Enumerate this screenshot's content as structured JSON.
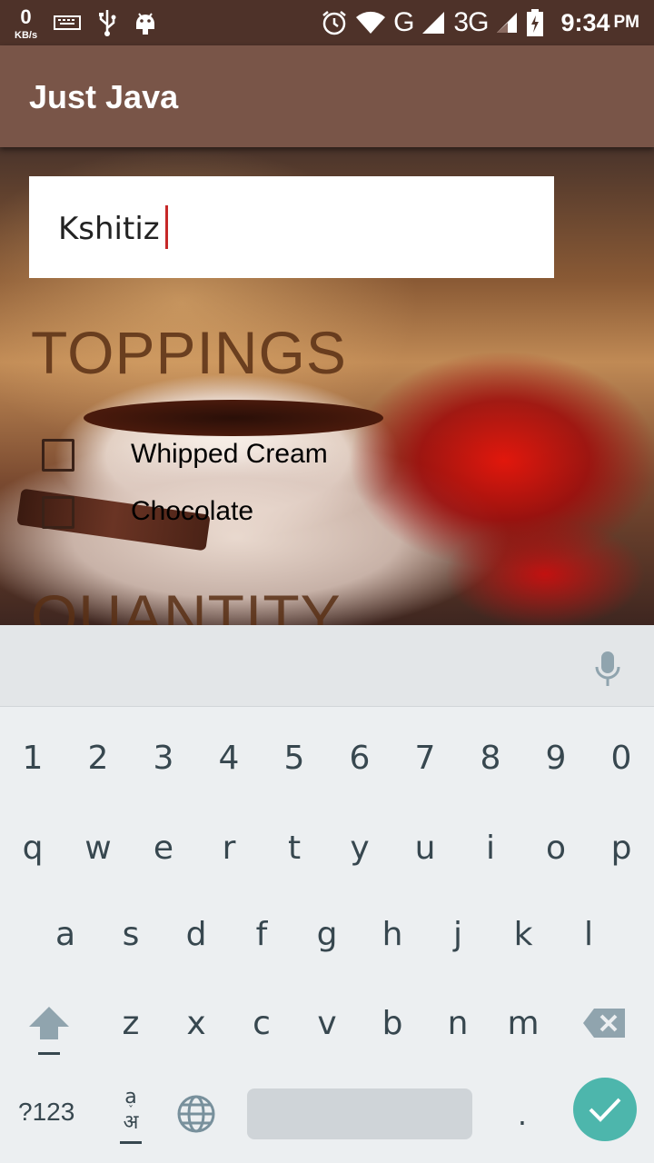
{
  "status_bar": {
    "speed_value": "0",
    "speed_unit": "KB/s",
    "network_g": "G",
    "network_3g": "3G",
    "time": "9:34",
    "ampm": "PM"
  },
  "app": {
    "title": "Just Java",
    "name_input_value": "Kshitiz",
    "toppings_title": "TOPPINGS",
    "quantity_title": "QUANTITY",
    "toppings": [
      {
        "label": "Whipped Cream",
        "checked": false
      },
      {
        "label": "Chocolate",
        "checked": false
      }
    ]
  },
  "keyboard": {
    "row_numbers": [
      "1",
      "2",
      "3",
      "4",
      "5",
      "6",
      "7",
      "8",
      "9",
      "0"
    ],
    "row_top": [
      "q",
      "w",
      "e",
      "r",
      "t",
      "y",
      "u",
      "i",
      "o",
      "p"
    ],
    "row_middle": [
      "a",
      "s",
      "d",
      "f",
      "g",
      "h",
      "j",
      "k",
      "l"
    ],
    "row_bottom": [
      "z",
      "x",
      "c",
      "v",
      "b",
      "n",
      "m"
    ],
    "symbols_label": "?123",
    "lang_top": "a",
    "lang_bottom": "अ",
    "period": ".",
    "icons": [
      "mic-icon",
      "shift-icon",
      "backspace-icon",
      "globe-icon",
      "check-icon"
    ],
    "accent_color": "#4db6ac"
  }
}
